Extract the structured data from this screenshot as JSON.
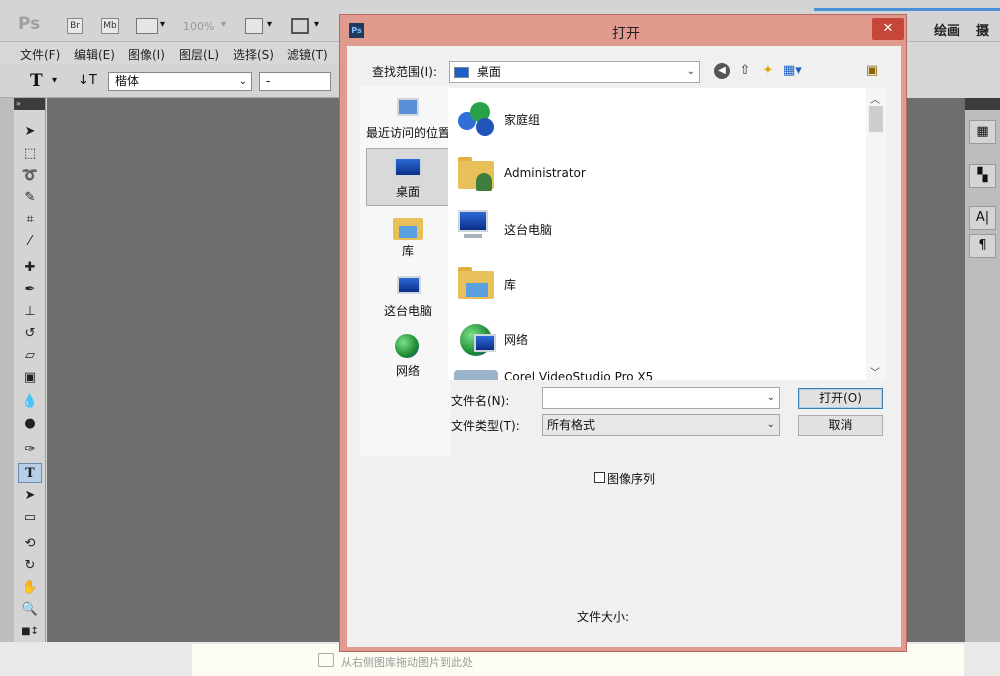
{
  "ps": {
    "logo": "Ps",
    "app_icons": [
      "Br",
      "Mb"
    ],
    "zoom": "100%",
    "menu": [
      "文件(F)",
      "编辑(E)",
      "图像(I)",
      "图层(L)",
      "选择(S)",
      "滤镜(T)"
    ],
    "workspace": "绘画",
    "workspace_more": "摄",
    "font_family": "楷体",
    "font_style": "-",
    "text_tool_glyph": "T",
    "drop_hint": "从右侧图库拖动图片到此处"
  },
  "dialog": {
    "title": "打开",
    "close_glyph": "✕",
    "lookin_label": "查找范围(I):",
    "lookin_value": "桌面",
    "places": [
      {
        "label": "最近访问的位置",
        "icon": "recent-places-icon"
      },
      {
        "label": "桌面",
        "icon": "desktop-icon",
        "selected": true
      },
      {
        "label": "库",
        "icon": "library-icon"
      },
      {
        "label": "这台电脑",
        "icon": "this-pc-icon"
      },
      {
        "label": "网络",
        "icon": "network-icon"
      }
    ],
    "files": [
      {
        "name": "家庭组",
        "icon": "homegroup-icon"
      },
      {
        "name": "Administrator",
        "icon": "user-folder-icon"
      },
      {
        "name": "这台电脑",
        "icon": "computer-icon"
      },
      {
        "name": "库",
        "icon": "library-folder-icon"
      },
      {
        "name": "网络",
        "icon": "network-icon"
      },
      {
        "name": "Corel VideoStudio Pro X5",
        "icon": "app-shortcut-icon"
      }
    ],
    "filename_label": "文件名(N):",
    "filename_value": "",
    "filetype_label": "文件类型(T):",
    "filetype_value": "所有格式",
    "open_button": "打开(O)",
    "cancel_button": "取消",
    "image_sequence": "图像序列",
    "filesize_label": "文件大小:"
  }
}
